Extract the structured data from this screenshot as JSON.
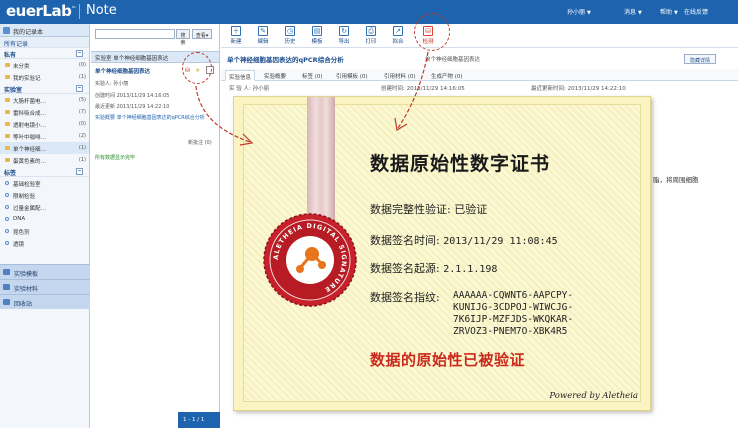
{
  "app": {
    "logo": "euerLab",
    "logo_tm": "™",
    "product": "Note"
  },
  "topbar": {
    "user": "孙小丽",
    "messages": "消息",
    "help": "帮助",
    "feedback": "在线反馈"
  },
  "sidebar": {
    "notebook": "我的记录本",
    "all_records": "所有记录",
    "sections": [
      {
        "label": "私有",
        "items": [
          {
            "label": "未分类",
            "count": "(0)"
          },
          {
            "label": "我的实验记",
            "count": "(1)"
          }
        ]
      },
      {
        "label": "实验室",
        "items": [
          {
            "label": "大肠杆菌电…",
            "count": "(5)"
          },
          {
            "label": "雷科吸合成…",
            "count": "(7)"
          },
          {
            "label": "透射电镜小…",
            "count": "(0)"
          },
          {
            "label": "等叶中咖啡…",
            "count": "(2)"
          },
          {
            "label": "单个神经细…",
            "count": "(1)"
          },
          {
            "label": "蛋黄色素的…",
            "count": "(1)"
          }
        ]
      },
      {
        "label": "标签",
        "items": [
          {
            "label": "基础检验室"
          },
          {
            "label": "限制检验"
          },
          {
            "label": "过量金属配…"
          },
          {
            "label": "DNA"
          },
          {
            "label": "昆色剂"
          },
          {
            "label": "透镜"
          }
        ]
      }
    ],
    "bottom_nav": [
      "实验模板",
      "实验材料",
      "回收站"
    ]
  },
  "list": {
    "search_placeholder": "",
    "search_btn": "搜索",
    "view_btn": "查看",
    "tab_label": "实验室 单个神经细胞基因表达",
    "entry": {
      "title": "单个神经细胞基因表达",
      "experimenter": "实验人: 孙小丽",
      "created": "创建时间 2013/11/29 14:16:05",
      "updated": "最近更新 2013/11/29 14:22:10",
      "summary": "实验概要 单个神经细胞基因表达的qPCR综合分析",
      "tags": "新批注 (0)",
      "shown": "所有数据显示完毕"
    },
    "pager": "1 - 1 / 1"
  },
  "toolbar": [
    "新建",
    "编辑",
    "历史",
    "模板",
    "导出",
    "打印",
    "拟合",
    "检测"
  ],
  "detail": {
    "title": "单个神经细胞基因表达的qPCR综合分析",
    "subtitle": "单个神经细胞基因表达",
    "detail_btn": "隐藏详情",
    "tabs": [
      "实验信息",
      "实验概要",
      "标签 (0)",
      "引用模板 (0)",
      "引用材料 (0)",
      "生成产物 (0)"
    ],
    "experimenter": "实 验 人: 孙小丽",
    "created": "创建时间: 2013/11/29 14:16:05",
    "updated": "最近更新时间: 2013/11/29 14:22:10",
    "body_text": "脂，将周围细胞"
  },
  "certificate": {
    "title": "数据原始性数字证书",
    "integrity_label": "数据完整性验证:",
    "integrity_value": "已验证",
    "sign_time_label": "数据签名时间:",
    "sign_time_value": "2013/11/29 11:08:45",
    "sign_origin_label": "数据签名起源:",
    "sign_origin_value": "2.1.1.198",
    "fingerprint_label": "数据签名指纹:",
    "fingerprint": [
      "AAAAAA-CQWNT6-AAPCPY-",
      "KUNIJG-3CDPOJ-WIWCJG-",
      "7K6IJP-MZFJDS-WKQKAR-",
      "ZRVOZ3-PNEM7O-XBK4R5"
    ],
    "verified": "数据的原始性已被验证",
    "powered": "Powered by Aletheia",
    "seal_text": "ALETHEIA DIGITAL SIGNATURE"
  },
  "colors": {
    "brand_blue": "#1e63ad",
    "callout_red": "#c0392b",
    "cert_red": "#c92a1e",
    "cert_bg": "#f9f4c2"
  }
}
